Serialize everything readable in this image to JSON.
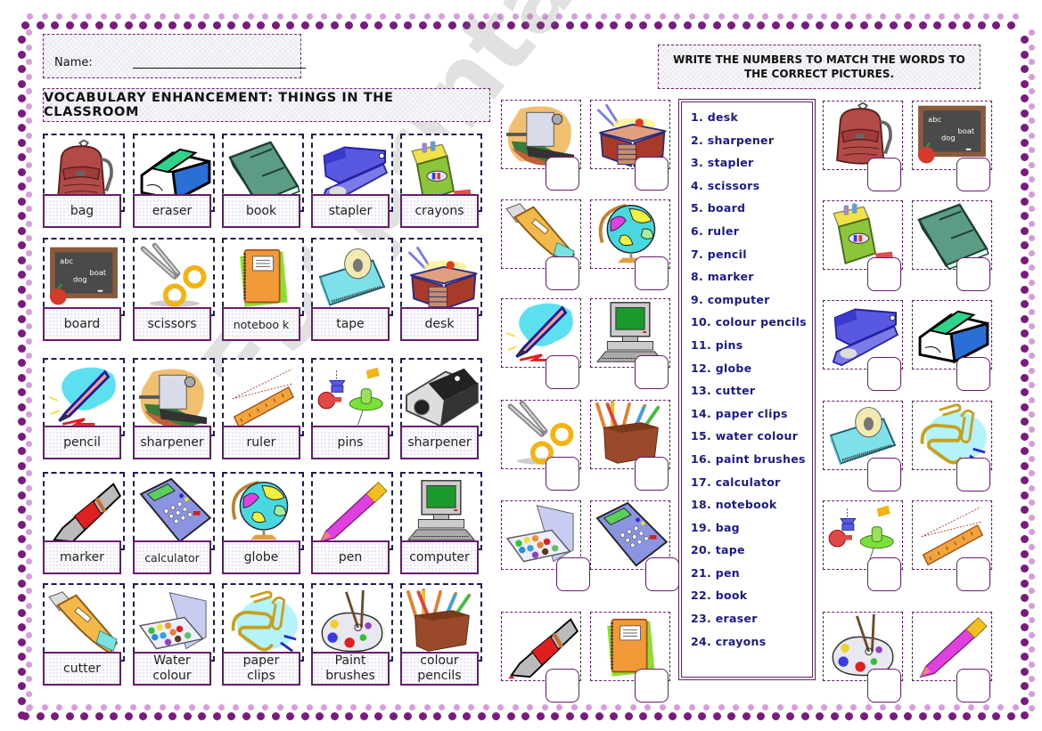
{
  "header": {
    "name_label": "Name:",
    "title": "VOCABULARY ENHANCEMENT: THINGS IN THE CLASSROOM",
    "instructions": "WRITE THE NUMBERS TO MATCH THE WORDS TO THE CORRECT PICTURES."
  },
  "colors": {
    "frame_dark": "#7a1a7e",
    "frame_light": "#d79cdc",
    "word_border": "#6a1a70",
    "pic_border": "#1c1c5c",
    "list_text": "#1a1a8c"
  },
  "vocabulary_cards": [
    {
      "word": "bag",
      "icon": "backpack-icon"
    },
    {
      "word": "eraser",
      "icon": "eraser-icon"
    },
    {
      "word": "book",
      "icon": "book-icon"
    },
    {
      "word": "stapler",
      "icon": "stapler-icon"
    },
    {
      "word": "crayons",
      "icon": "crayons-icon"
    },
    {
      "word": "board",
      "icon": "chalkboard-icon"
    },
    {
      "word": "scissors",
      "icon": "scissors-icon"
    },
    {
      "word": "noteboo k",
      "icon": "notebook-icon"
    },
    {
      "word": "tape",
      "icon": "tape-dispenser-icon"
    },
    {
      "word": "desk",
      "icon": "desk-icon"
    },
    {
      "word": "pencil",
      "icon": "pencil-icon"
    },
    {
      "word": "sharpener",
      "icon": "crank-sharpener-icon"
    },
    {
      "word": "ruler",
      "icon": "ruler-icon"
    },
    {
      "word": "pins",
      "icon": "pushpins-icon"
    },
    {
      "word": "sharpener",
      "icon": "sharpener-icon"
    },
    {
      "word": "marker",
      "icon": "marker-icon"
    },
    {
      "word": "calculator",
      "icon": "calculator-icon"
    },
    {
      "word": "globe",
      "icon": "globe-icon"
    },
    {
      "word": "pen",
      "icon": "pen-icon"
    },
    {
      "word": "computer",
      "icon": "computer-icon"
    },
    {
      "word": "cutter",
      "icon": "cutter-icon"
    },
    {
      "word": "Water colour",
      "icon": "watercolour-icon"
    },
    {
      "word": "paper clips",
      "icon": "paperclips-icon"
    },
    {
      "word": "Paint brushes",
      "icon": "palette-icon"
    },
    {
      "word": "colour pencils",
      "icon": "pencil-cup-icon"
    }
  ],
  "word_list": [
    "1. desk",
    "2.  sharpener",
    "3.  stapler",
    "4.  scissors",
    "5. board",
    "6. ruler",
    "7. pencil",
    "8. marker",
    "9. computer",
    "10. colour pencils",
    "11.  pins",
    "12.  globe",
    "13.  cutter",
    "14.  paper clips",
    "15.  water colour",
    "16.  paint brushes",
    "17.  calculator",
    "18.  notebook",
    "19.  bag",
    "20.  tape",
    "21.  pen",
    "22.  book",
    "23.  eraser",
    "24.  crayons"
  ],
  "matching_pictures_left": [
    {
      "icon": "crank-sharpener-icon",
      "answer": ""
    },
    {
      "icon": "desk-icon",
      "answer": ""
    },
    {
      "icon": "cutter-icon",
      "answer": ""
    },
    {
      "icon": "globe-icon",
      "answer": ""
    },
    {
      "icon": "pencil-icon",
      "answer": ""
    },
    {
      "icon": "computer-icon",
      "answer": ""
    },
    {
      "icon": "scissors-icon",
      "answer": ""
    },
    {
      "icon": "pencil-cup-icon",
      "answer": ""
    },
    {
      "icon": "watercolour-icon",
      "answer": ""
    },
    {
      "icon": "calculator-icon",
      "answer": ""
    },
    {
      "icon": "marker-icon",
      "answer": ""
    },
    {
      "icon": "notebook-icon",
      "answer": ""
    }
  ],
  "matching_pictures_right": [
    {
      "icon": "backpack-icon",
      "answer": ""
    },
    {
      "icon": "chalkboard-icon",
      "answer": ""
    },
    {
      "icon": "crayons-icon",
      "answer": ""
    },
    {
      "icon": "book-icon",
      "answer": ""
    },
    {
      "icon": "stapler-icon",
      "answer": ""
    },
    {
      "icon": "eraser-icon",
      "answer": ""
    },
    {
      "icon": "tape-dispenser-icon",
      "answer": ""
    },
    {
      "icon": "paperclips-icon",
      "answer": ""
    },
    {
      "icon": "pushpins-icon",
      "answer": ""
    },
    {
      "icon": "ruler-icon",
      "answer": ""
    },
    {
      "icon": "palette-icon",
      "answer": ""
    },
    {
      "icon": "pen-icon",
      "answer": ""
    }
  ],
  "chalkboard_words": [
    "abc",
    "boat",
    "dog"
  ],
  "watermark": "ESLprintables.com"
}
